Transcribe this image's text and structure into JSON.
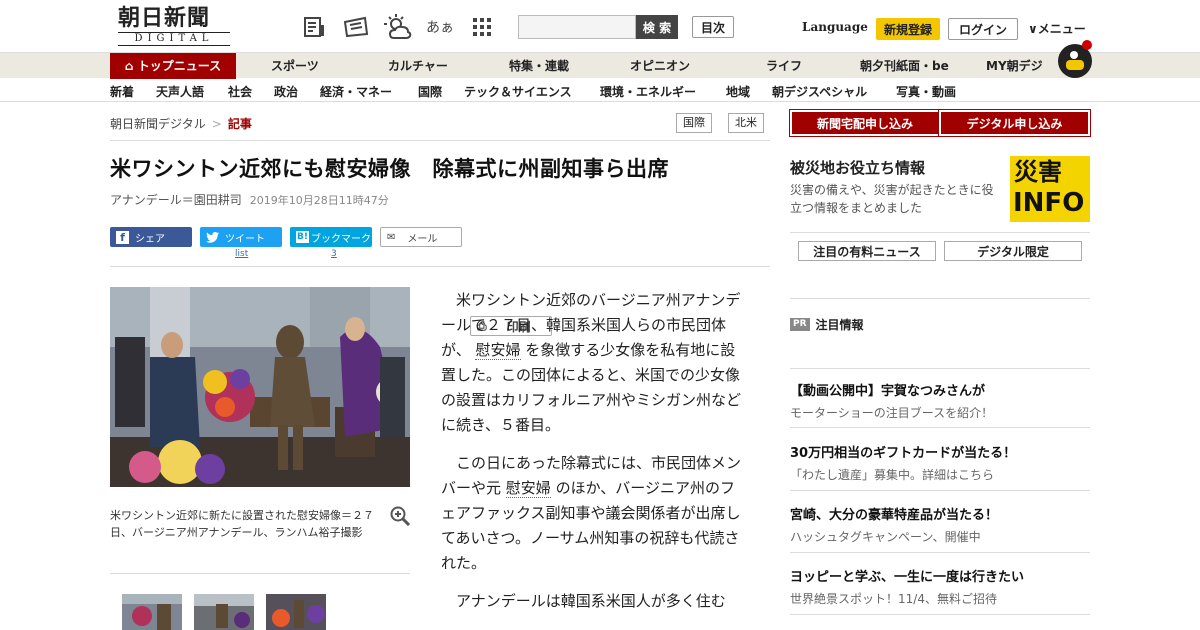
{
  "header": {
    "logo_main": "朝日新聞",
    "logo_sub": "DIGITAL",
    "icons": [
      "paper-icon",
      "news-icon",
      "weather-icon",
      "font-size-icon",
      "grid-icon"
    ],
    "font_size_label": "あぁ",
    "search_placeholder": "",
    "search_button": "検 索",
    "toc_button": "目次",
    "language": "Language",
    "register": "新規登録",
    "login": "ログイン",
    "menu": "∨メニュー"
  },
  "nav_primary": [
    "トップニュース",
    "スポーツ",
    "カルチャー",
    "特集・連載",
    "オピニオン",
    "ライフ",
    "朝夕刊紙面・be",
    "MY朝デジ"
  ],
  "nav_secondary": [
    "新着",
    "天声人語",
    "社会",
    "政治",
    "経済・マネー",
    "国際",
    "テック＆サイエンス",
    "環境・エネルギー",
    "地域",
    "朝デジスペシャル",
    "写真・動画"
  ],
  "breadcrumb": {
    "home": "朝日新聞デジタル",
    "sep": ">",
    "current": "記事"
  },
  "tags": [
    "国際",
    "北米"
  ],
  "article": {
    "title": "米ワシントン近郊にも慰安婦像　除幕式に州副知事ら出席",
    "author": "アナンデール＝園田耕司",
    "datetime": "2019年10月28日11時47分",
    "share": {
      "facebook": "シェア",
      "twitter": "ツイート",
      "twitter_count": "list",
      "hatena": "ブックマーク",
      "hatena_badge": "B!",
      "hatena_count": "3",
      "mail": "メール",
      "print": "印刷"
    },
    "photo_caption": "米ワシントン近郊に新たに設置された慰安婦像＝２７日、バージニア州アナンデール、ランハム裕子撮影",
    "p1_a": "米ワシントン近郊のバージニア州アナンデールで２７日、韓国系米国人らの市民団体が、",
    "p1_link": "慰安婦",
    "p1_b": "を象徴する少女像を私有地に設置した。この団体によると、米国での少女像の設置はカリフォルニア州やミシガン州などに続き、５番目。",
    "p2_a": "この日にあった除幕式には、市民団体メンバーや元",
    "p2_link": "慰安婦",
    "p2_b": "のほか、バージニア州のフェアファックス副知事や議会関係者が出席してあいさつ。ノーサム州知事の祝辞も代読された。",
    "p3": "アナンデールは韓国系米国人が多く住む"
  },
  "sidebar": {
    "subscribe_paper": "新聞宅配申し込み",
    "subscribe_digital": "デジタル申し込み",
    "disaster_title": "被災地お役立ち情報",
    "disaster_text": "災害の備えや、災害が起きたときに役立つ情報をまとめました",
    "disaster_badge_1": "災害",
    "disaster_badge_2": "INFO",
    "tab_paid": "注目の有料ニュース",
    "tab_digital": "デジタル限定",
    "pr_badge": "PR",
    "pr_label": "注目情報",
    "pr_items": [
      {
        "title": "【動画公開中】宇賀なつみさんが",
        "sub": "モーターショーの注目ブースを紹介！"
      },
      {
        "title": "30万円相当のギフトカードが当たる！",
        "sub": "「わたし遺産」募集中。詳細はこちら"
      },
      {
        "title": "宮崎、大分の豪華特産品が当たる！",
        "sub": "ハッシュタグキャンペーン、開催中"
      },
      {
        "title": "ヨッピーと学ぶ、一生に一度は行きたい",
        "sub": "世界絶景スポット！11/4、無料ご招待"
      }
    ]
  }
}
